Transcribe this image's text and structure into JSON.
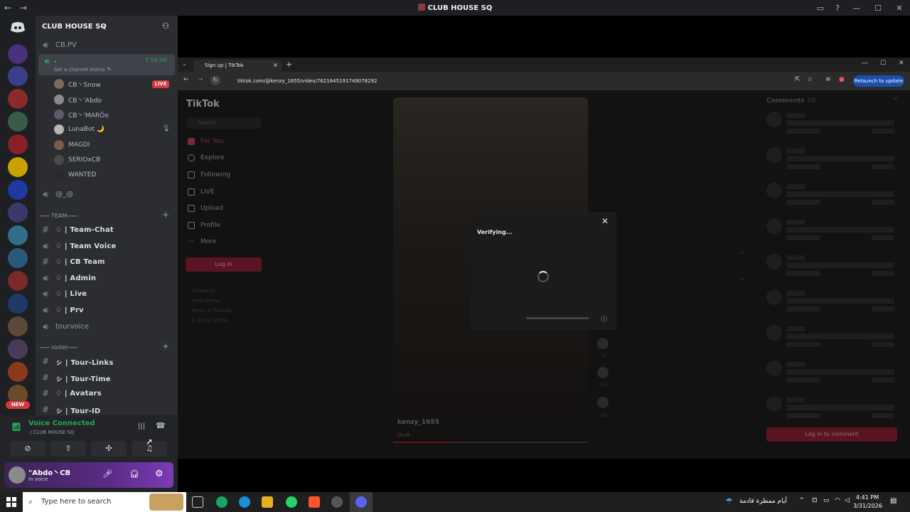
{
  "window": {
    "title": "CLUB HOUSE SQ"
  },
  "server": {
    "name": "CLUB HOUSE SQ",
    "new_badge": "NEW"
  },
  "channels": {
    "top": [
      {
        "name": "CB.PV"
      },
      {
        "name": ".",
        "timer": "7:56:06",
        "status_hint": "Set a channel status"
      }
    ],
    "voice_users": [
      {
        "name": "CB丶Snow",
        "badge": "LIVE"
      },
      {
        "name": "CB丶'Abdo"
      },
      {
        "name": "CB丶'MARÖo"
      },
      {
        "name": "LunaBot 🌙"
      },
      {
        "name": "MAGDI"
      },
      {
        "name": "SERIOxCB"
      },
      {
        "name": "WANTED"
      }
    ],
    "misc": {
      "name": "@_@"
    },
    "team_category": "-̶-̶-̶-̶ TEAM -̶-̶-̶-̶",
    "team_channels": [
      {
        "name": "♢ | Team-Chat"
      },
      {
        "name": "♢ | Team Voice"
      },
      {
        "name": "♢ | CB Team"
      },
      {
        "name": "♢ | Admin"
      },
      {
        "name": "♢ | Live"
      },
      {
        "name": "♢ | Prv"
      },
      {
        "name": "tourvoice"
      }
    ],
    "roster_category": "-̶-̶-̶-̶ roster -̶-̶-̶-̶",
    "roster_channels": [
      {
        "name": "ㇱ | Tour-Links"
      },
      {
        "name": "ㇱ | Tour-Time"
      },
      {
        "name": "♢ | Avatars"
      },
      {
        "name": "ㇱ | Tour-ID"
      }
    ]
  },
  "voice_panel": {
    "status": "Voice Connected",
    "channel": "./ CLUB HOUSE SQ"
  },
  "user_panel": {
    "name": "\"Abdo丶CB",
    "status": "In voice"
  },
  "browser": {
    "tab_title": "Sign up | TikTok",
    "url": "tiktok.com/@kenzy_1655/video/7621645191749078292",
    "relaunch_label": "Relaunch to update"
  },
  "tiktok": {
    "logo": "TikTok",
    "search_placeholder": "Search",
    "nav": [
      "For You",
      "Explore",
      "Following",
      "LIVE",
      "Upload",
      "Profile",
      "More"
    ],
    "login_button": "Log in",
    "footer": [
      "Company",
      "Programme",
      "Terms & Policies",
      "© 2026 TikTok"
    ],
    "video_author": "kenzy_1655",
    "video_desc": "Draft",
    "counts": [
      "2022",
      "20",
      "571",
      "141"
    ],
    "comments_header": "Comments",
    "comments_count": "20",
    "comment_login": "Log in to comment"
  },
  "dialog": {
    "title": "Verifying..."
  },
  "taskbar": {
    "search_placeholder": "Type here to search",
    "weather": "أيام ممطرة قادمة",
    "time": "4:41 PM",
    "date": "3/31/2026"
  }
}
